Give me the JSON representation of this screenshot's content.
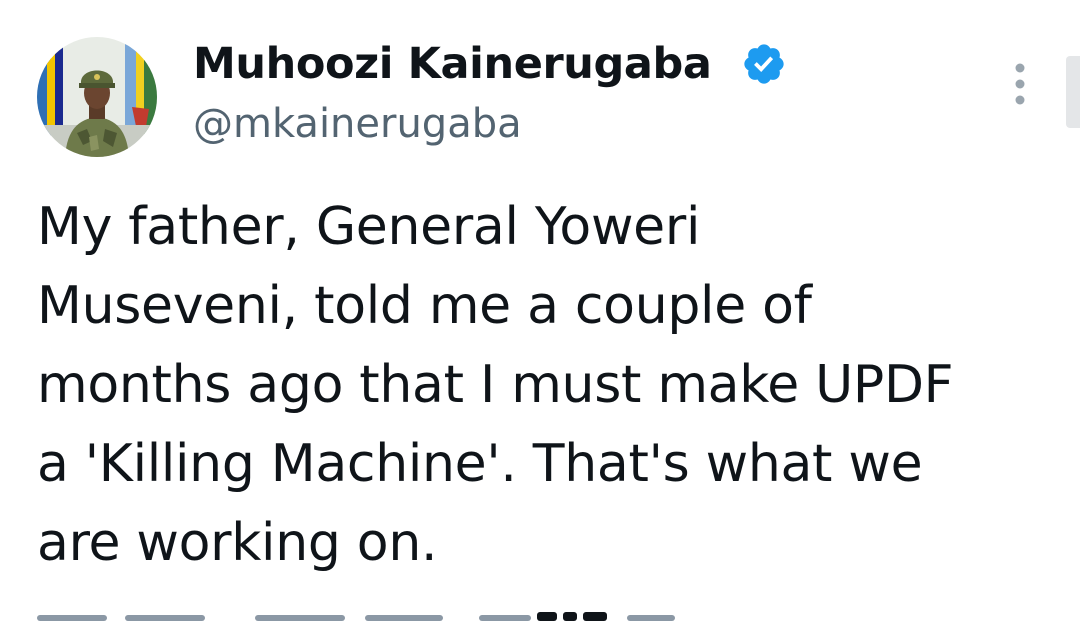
{
  "tweet": {
    "author": {
      "display_name": "Muhoozi Kainerugaba",
      "handle": "@mkainerugaba",
      "verified": true,
      "verified_icon": "verified-badge-icon",
      "avatar_icon": "avatar"
    },
    "menu_icon": "more-vertical-icon",
    "text_lines": [
      "My father, General Yoweri",
      "Museveni, told me a couple of",
      "months ago that I must make UPDF",
      "a 'Killing Machine'. That's what we",
      "are working on."
    ]
  },
  "colors": {
    "text_primary": "#0f1419",
    "text_secondary": "#536471",
    "verified_blue": "#1d9bf0",
    "background": "#ffffff"
  }
}
